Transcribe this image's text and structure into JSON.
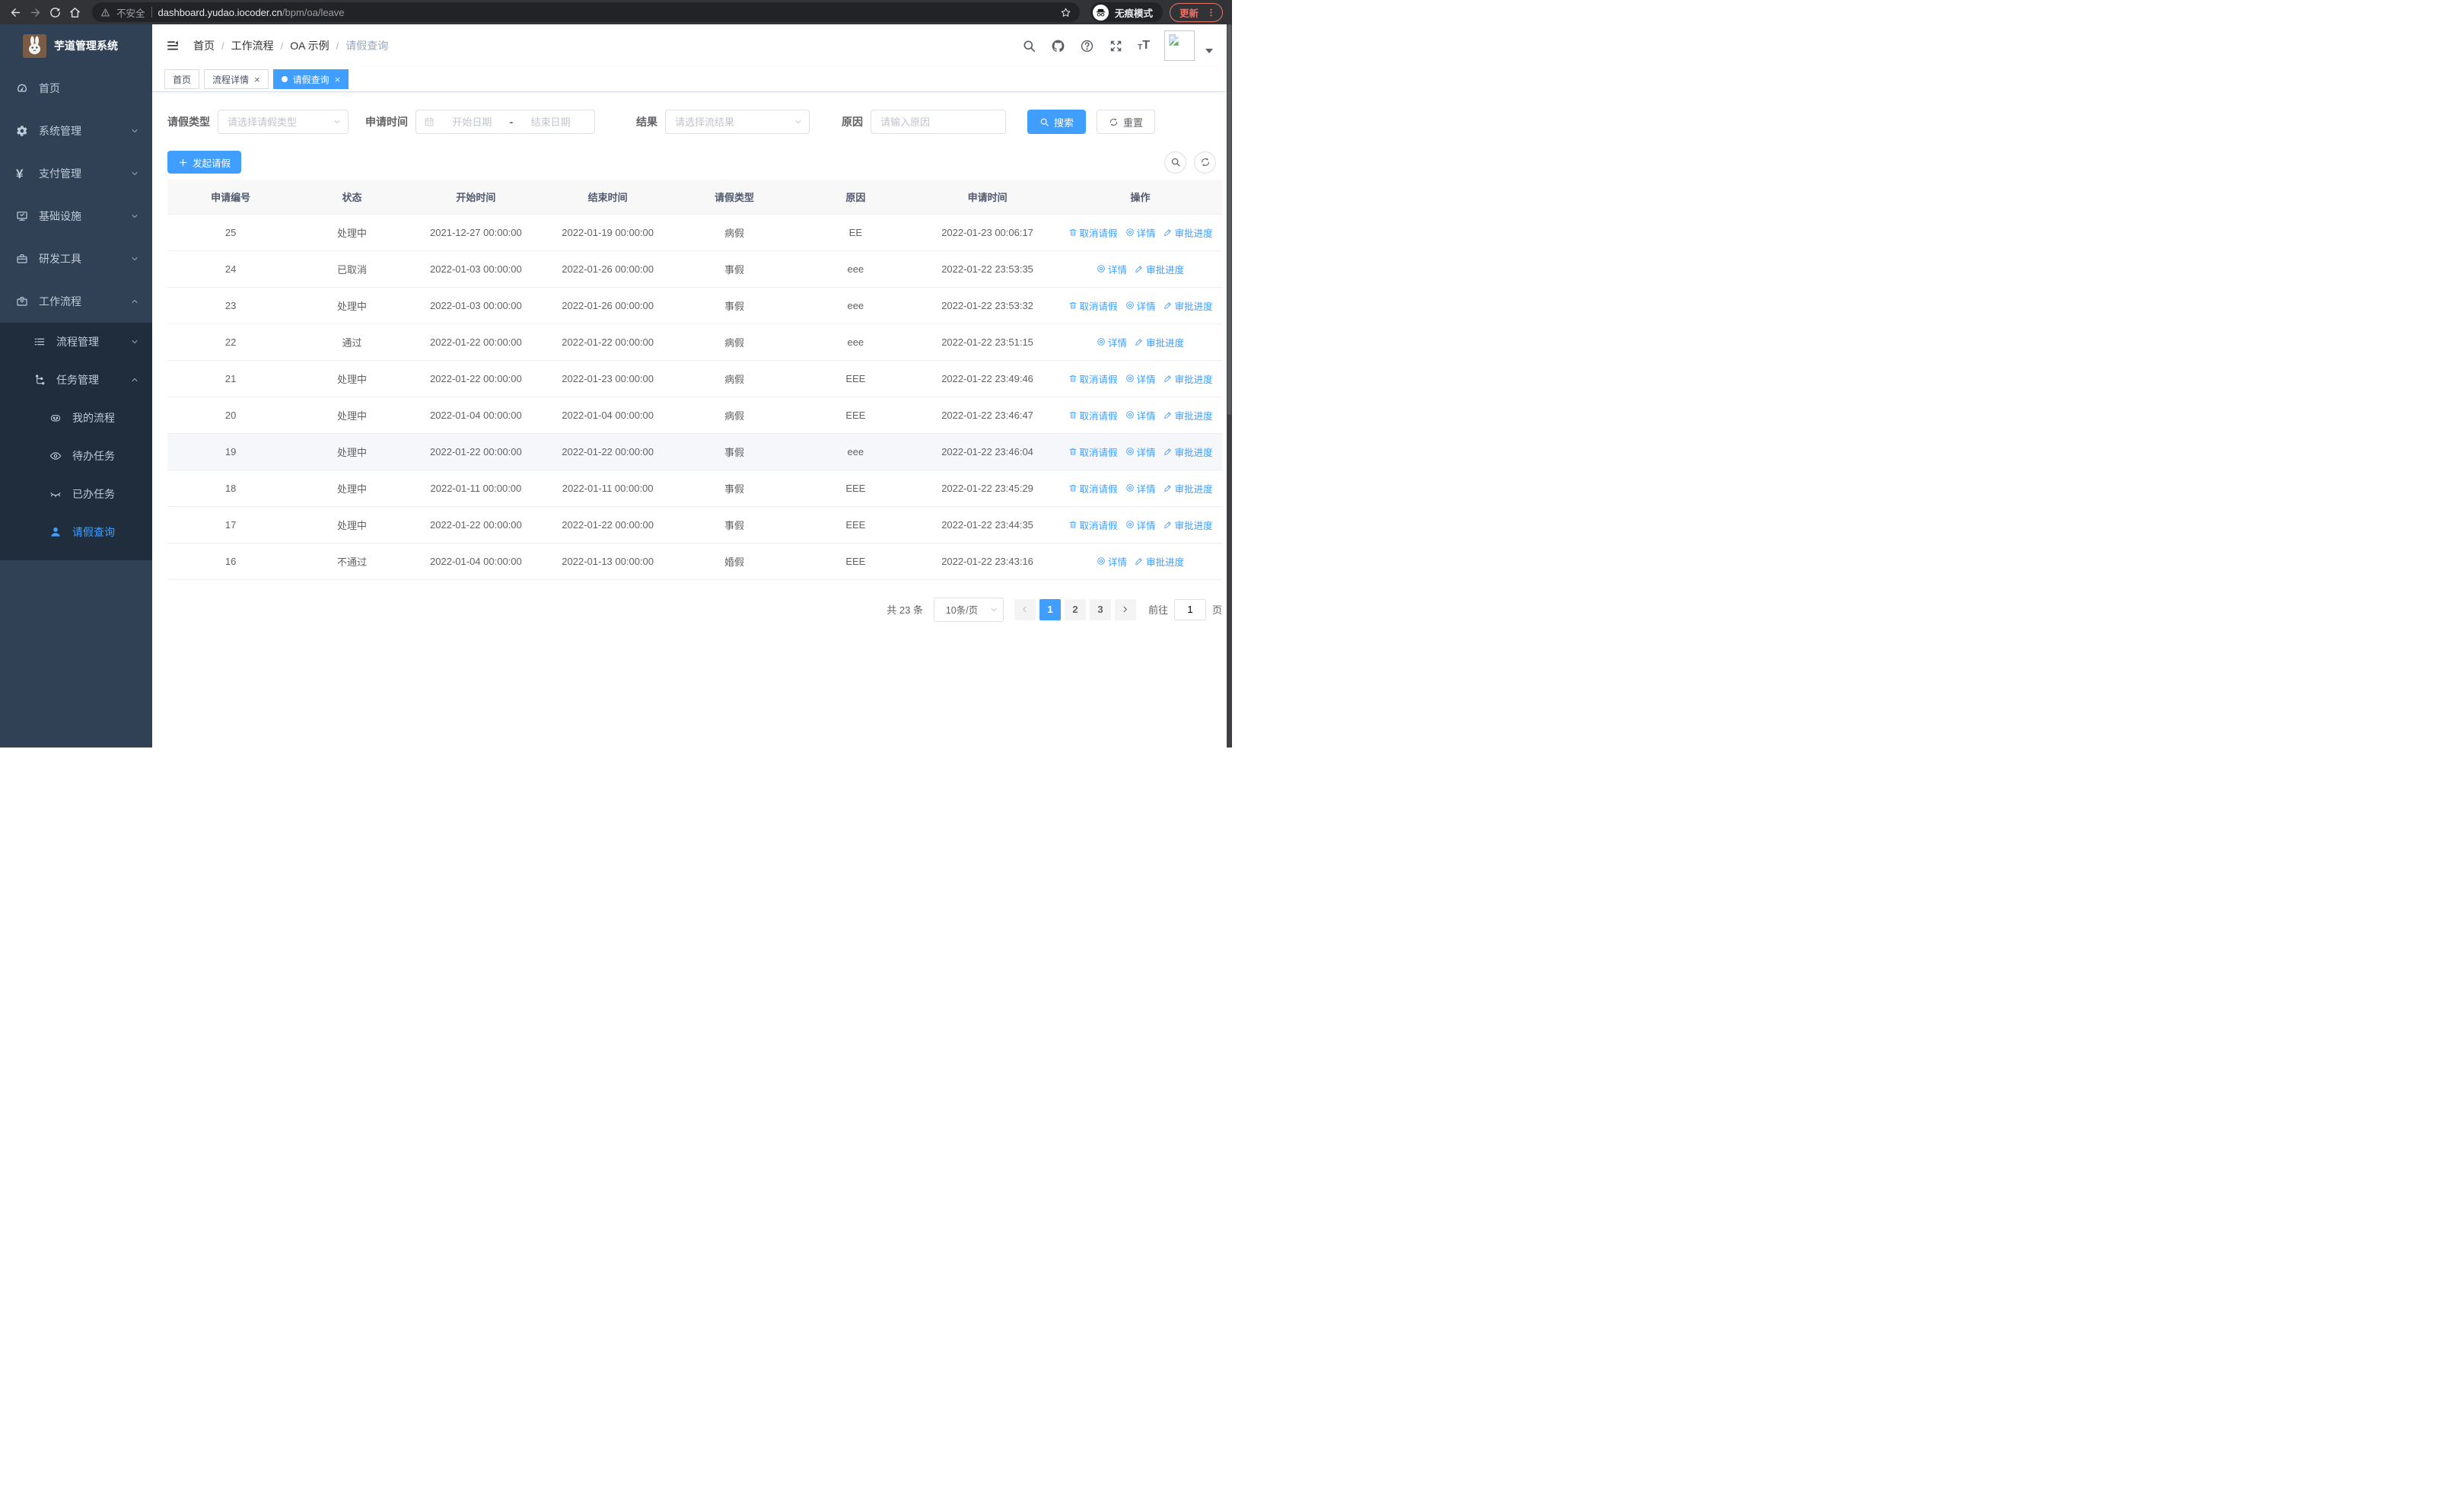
{
  "browser": {
    "security_label": "不安全",
    "url_host": "dashboard.yudao.iocoder.cn",
    "url_path": "/bpm/oa/leave",
    "incognito_label": "无痕模式",
    "update_label": "更新"
  },
  "sidebar": {
    "title": "芋道管理系统",
    "menu": [
      {
        "id": "home",
        "label": "首页",
        "icon": "dashboard-icon",
        "expandable": false,
        "expanded": false
      },
      {
        "id": "system",
        "label": "系统管理",
        "icon": "gear-icon",
        "expandable": true,
        "expanded": false
      },
      {
        "id": "payment",
        "label": "支付管理",
        "icon": "yen-icon",
        "expandable": true,
        "expanded": false
      },
      {
        "id": "infra",
        "label": "基础设施",
        "icon": "monitor-icon",
        "expandable": true,
        "expanded": false
      },
      {
        "id": "devtools",
        "label": "研发工具",
        "icon": "toolbox-icon",
        "expandable": true,
        "expanded": false
      },
      {
        "id": "workflow",
        "label": "工作流程",
        "icon": "briefcase-icon",
        "expandable": true,
        "expanded": true,
        "children": [
          {
            "id": "process-manage",
            "label": "流程管理",
            "icon": "list-icon",
            "expandable": true,
            "expanded": false
          },
          {
            "id": "task-manage",
            "label": "任务管理",
            "icon": "tree-icon",
            "expandable": true,
            "expanded": true,
            "children": [
              {
                "id": "my-process",
                "label": "我的流程",
                "icon": "robot-icon",
                "expandable": false,
                "expanded": false
              },
              {
                "id": "todo-task",
                "label": "待办任务",
                "icon": "eye-open-icon",
                "expandable": false,
                "expanded": false
              },
              {
                "id": "done-task",
                "label": "已办任务",
                "icon": "eye-closed-icon",
                "expandable": false,
                "expanded": false
              },
              {
                "id": "leave-query",
                "label": "请假查询",
                "icon": "user-icon",
                "expandable": false,
                "expanded": false,
                "active": true
              }
            ]
          }
        ]
      }
    ]
  },
  "header": {
    "breadcrumb": [
      "首页",
      "工作流程",
      "OA 示例",
      "请假查询"
    ]
  },
  "tabs": [
    {
      "id": "home",
      "label": "首页",
      "closable": false,
      "active": false
    },
    {
      "id": "process-detail",
      "label": "流程详情",
      "closable": true,
      "active": false
    },
    {
      "id": "leave-query",
      "label": "请假查询",
      "closable": true,
      "active": true
    }
  ],
  "filters": {
    "leave_type": {
      "label": "请假类型",
      "placeholder": "请选择请假类型"
    },
    "apply_time": {
      "label": "申请时间",
      "start_placeholder": "开始日期",
      "separator": "-",
      "end_placeholder": "结束日期"
    },
    "result": {
      "label": "结果",
      "placeholder": "请选择流结果"
    },
    "reason": {
      "label": "原因",
      "placeholder": "请输入原因"
    },
    "search_button": "搜索",
    "reset_button": "重置"
  },
  "toolbar": {
    "create_button": "发起请假"
  },
  "table": {
    "columns": [
      "申请编号",
      "状态",
      "开始时间",
      "结束时间",
      "请假类型",
      "原因",
      "申请时间",
      "操作"
    ],
    "action_labels": {
      "cancel": "取消请假",
      "detail": "详情",
      "progress": "审批进度"
    },
    "rows": [
      {
        "id": "25",
        "status": "处理中",
        "start": "2021-12-27 00:00:00",
        "end": "2022-01-19 00:00:00",
        "type": "病假",
        "reason": "EE",
        "applied": "2022-01-23 00:06:17",
        "actions": [
          "cancel",
          "detail",
          "progress"
        ],
        "hover": false
      },
      {
        "id": "24",
        "status": "已取消",
        "start": "2022-01-03 00:00:00",
        "end": "2022-01-26 00:00:00",
        "type": "事假",
        "reason": "eee",
        "applied": "2022-01-22 23:53:35",
        "actions": [
          "detail",
          "progress"
        ],
        "hover": false
      },
      {
        "id": "23",
        "status": "处理中",
        "start": "2022-01-03 00:00:00",
        "end": "2022-01-26 00:00:00",
        "type": "事假",
        "reason": "eee",
        "applied": "2022-01-22 23:53:32",
        "actions": [
          "cancel",
          "detail",
          "progress"
        ],
        "hover": false
      },
      {
        "id": "22",
        "status": "通过",
        "start": "2022-01-22 00:00:00",
        "end": "2022-01-22 00:00:00",
        "type": "病假",
        "reason": "eee",
        "applied": "2022-01-22 23:51:15",
        "actions": [
          "detail",
          "progress"
        ],
        "hover": false
      },
      {
        "id": "21",
        "status": "处理中",
        "start": "2022-01-22 00:00:00",
        "end": "2022-01-23 00:00:00",
        "type": "病假",
        "reason": "EEE",
        "applied": "2022-01-22 23:49:46",
        "actions": [
          "cancel",
          "detail",
          "progress"
        ],
        "hover": false
      },
      {
        "id": "20",
        "status": "处理中",
        "start": "2022-01-04 00:00:00",
        "end": "2022-01-04 00:00:00",
        "type": "病假",
        "reason": "EEE",
        "applied": "2022-01-22 23:46:47",
        "actions": [
          "cancel",
          "detail",
          "progress"
        ],
        "hover": false
      },
      {
        "id": "19",
        "status": "处理中",
        "start": "2022-01-22 00:00:00",
        "end": "2022-01-22 00:00:00",
        "type": "事假",
        "reason": "eee",
        "applied": "2022-01-22 23:46:04",
        "actions": [
          "cancel",
          "detail",
          "progress"
        ],
        "hover": true
      },
      {
        "id": "18",
        "status": "处理中",
        "start": "2022-01-11 00:00:00",
        "end": "2022-01-11 00:00:00",
        "type": "事假",
        "reason": "EEE",
        "applied": "2022-01-22 23:45:29",
        "actions": [
          "cancel",
          "detail",
          "progress"
        ],
        "hover": false
      },
      {
        "id": "17",
        "status": "处理中",
        "start": "2022-01-22 00:00:00",
        "end": "2022-01-22 00:00:00",
        "type": "事假",
        "reason": "EEE",
        "applied": "2022-01-22 23:44:35",
        "actions": [
          "cancel",
          "detail",
          "progress"
        ],
        "hover": false
      },
      {
        "id": "16",
        "status": "不通过",
        "start": "2022-01-04 00:00:00",
        "end": "2022-01-13 00:00:00",
        "type": "婚假",
        "reason": "EEE",
        "applied": "2022-01-22 23:43:16",
        "actions": [
          "detail",
          "progress"
        ],
        "hover": false
      }
    ]
  },
  "pagination": {
    "total_text": "共 23 条",
    "page_size": "10条/页",
    "pages": [
      "1",
      "2",
      "3"
    ],
    "current": "1",
    "goto_label": "前往",
    "goto_value": "1",
    "goto_suffix": "页"
  },
  "colors": {
    "accent": "#409eff",
    "sidebar_bg": "#304156",
    "sidebar_submenu_bg": "#1f2d3d",
    "sidebar_text": "#bfcbd9",
    "table_header_bg": "#f8f8f9",
    "row_hover_bg": "#f5f7fa",
    "chrome_bg": "#323337",
    "update_pill": "#e5756a"
  }
}
